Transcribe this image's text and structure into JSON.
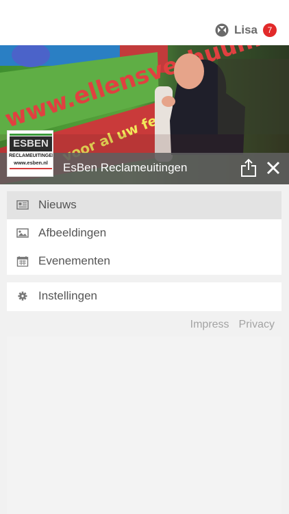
{
  "header": {
    "user_name": "Lisa",
    "notification_count": "7",
    "user_icon": "puzzle-logo-icon"
  },
  "hero": {
    "title": "EsBen Reclameuitingen",
    "image_text": "www.ellensverhuur.nl",
    "image_text_2": "voor al uw feesten",
    "share_icon": "share-icon",
    "close_icon": "close-icon"
  },
  "logo": {
    "brand": "ESBEN",
    "subtitle": "RECLAMEUITINGEN",
    "url": "www.esben.nl"
  },
  "menu": {
    "items": [
      {
        "label": "Nieuws",
        "icon": "newspaper-icon",
        "active": true
      },
      {
        "label": "Afbeeldingen",
        "icon": "image-icon",
        "active": false
      },
      {
        "label": "Evenementen",
        "icon": "calendar-icon",
        "active": false
      }
    ],
    "settings": {
      "label": "Instellingen",
      "icon": "gear-icon"
    }
  },
  "footer": {
    "impress": "Impress",
    "privacy": "Privacy"
  },
  "colors": {
    "badge": "#e22a2a",
    "active_row": "#e3e3e3",
    "background": "#f1f1f1",
    "hero_bar": "#5f5f5f"
  }
}
